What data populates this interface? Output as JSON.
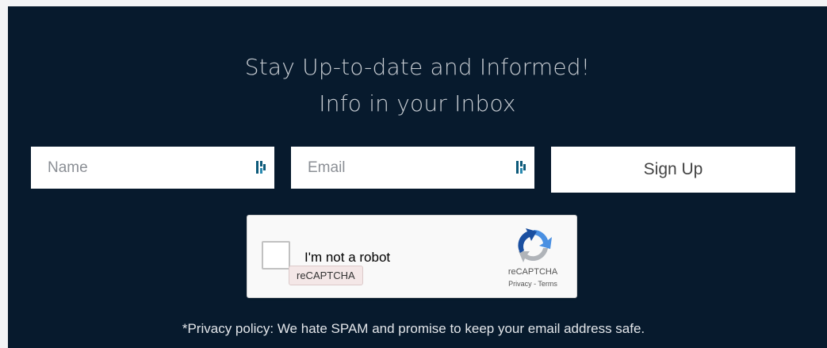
{
  "heading": {
    "line1": "Stay Up-to-date and Informed!",
    "line2": "Info in your Inbox"
  },
  "form": {
    "name_placeholder": "Name",
    "email_placeholder": "Email",
    "name_value": "",
    "email_value": "",
    "signup_label": "Sign Up",
    "field_icon": "password-manager-icon"
  },
  "captcha": {
    "label": "I'm not a robot",
    "tooltip": "reCAPTCHA",
    "brand": "reCAPTCHA",
    "links": "Privacy - Terms",
    "checked": false,
    "logo_icon": "recaptcha-logo-icon"
  },
  "privacy_note": "*Privacy policy: We hate SPAM and promise to keep your email address safe.",
  "colors": {
    "panel_bg": "#071a2d",
    "heading_text": "#c7ccd2",
    "field_bg": "#ffffff"
  }
}
